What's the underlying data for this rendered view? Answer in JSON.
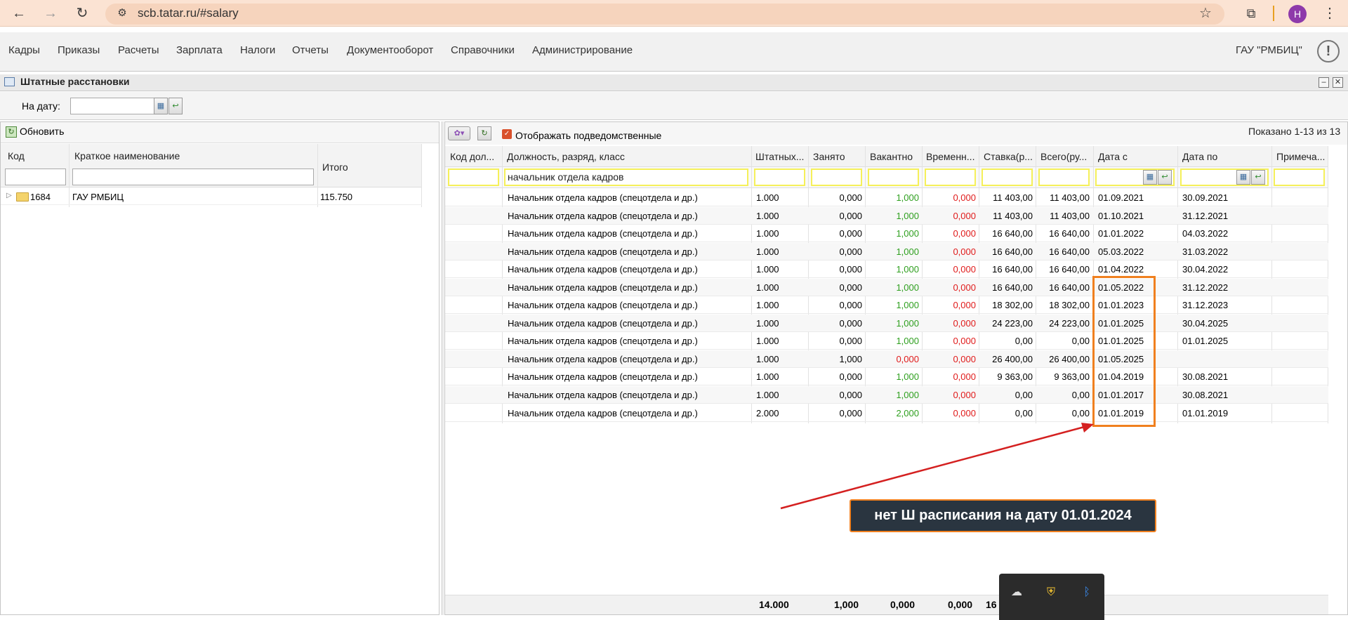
{
  "browser": {
    "url": "scb.tatar.ru/#salary",
    "profile_initial": "H"
  },
  "menu": {
    "items": [
      "Кадры",
      "Приказы",
      "Расчеты",
      "Зарплата",
      "Налоги",
      "Отчеты",
      "Документооборот",
      "Справочники",
      "Администрирование"
    ],
    "org": "ГАУ \"РМБИЦ\""
  },
  "window": {
    "title": "Штатные расстановки",
    "date_label": "На дату:",
    "date_value": ""
  },
  "left": {
    "refresh_label": "Обновить",
    "headers": [
      "Код",
      "Краткое наименование",
      "Итого"
    ],
    "tree": [
      {
        "code": "1684",
        "name": "ГАУ РМБИЦ",
        "total": "115.750"
      }
    ]
  },
  "right": {
    "show_subordinate_label": "Отображать подведомственные",
    "show_subordinate_checked": true,
    "shown_text": "Показано 1-13 из 13",
    "headers": [
      "Код дол...",
      "Должность, разряд, класс",
      "Штатных...",
      "Занято",
      "Вакантно",
      "Временн...",
      "Ставка(р...",
      "Всего(ру...",
      "Дата с",
      "Дата по",
      "Примеча..."
    ],
    "filter_position": "начальник отдела кадров",
    "rows": [
      {
        "pos": "Начальник отдела кадров (спецотдела и др.)",
        "shtat": "1.000",
        "zanyato": "0,000",
        "vakant": "1,000",
        "vrem": "0,000",
        "stavka": "11 403,00",
        "vsego": "11 403,00",
        "date_from": "01.09.2021",
        "date_to": "30.09.2021"
      },
      {
        "pos": "Начальник отдела кадров (спецотдела и др.)",
        "shtat": "1.000",
        "zanyato": "0,000",
        "vakant": "1,000",
        "vrem": "0,000",
        "stavka": "11 403,00",
        "vsego": "11 403,00",
        "date_from": "01.10.2021",
        "date_to": "31.12.2021"
      },
      {
        "pos": "Начальник отдела кадров (спецотдела и др.)",
        "shtat": "1.000",
        "zanyato": "0,000",
        "vakant": "1,000",
        "vrem": "0,000",
        "stavka": "16 640,00",
        "vsego": "16 640,00",
        "date_from": "01.01.2022",
        "date_to": "04.03.2022"
      },
      {
        "pos": "Начальник отдела кадров (спецотдела и др.)",
        "shtat": "1.000",
        "zanyato": "0,000",
        "vakant": "1,000",
        "vrem": "0,000",
        "stavka": "16 640,00",
        "vsego": "16 640,00",
        "date_from": "05.03.2022",
        "date_to": "31.03.2022"
      },
      {
        "pos": "Начальник отдела кадров (спецотдела и др.)",
        "shtat": "1.000",
        "zanyato": "0,000",
        "vakant": "1,000",
        "vrem": "0,000",
        "stavka": "16 640,00",
        "vsego": "16 640,00",
        "date_from": "01.04.2022",
        "date_to": "30.04.2022"
      },
      {
        "pos": "Начальник отдела кадров (спецотдела и др.)",
        "shtat": "1.000",
        "zanyato": "0,000",
        "vakant": "1,000",
        "vrem": "0,000",
        "stavka": "16 640,00",
        "vsego": "16 640,00",
        "date_from": "01.05.2022",
        "date_to": "31.12.2022"
      },
      {
        "pos": "Начальник отдела кадров (спецотдела и др.)",
        "shtat": "1.000",
        "zanyato": "0,000",
        "vakant": "1,000",
        "vrem": "0,000",
        "stavka": "18 302,00",
        "vsego": "18 302,00",
        "date_from": "01.01.2023",
        "date_to": "31.12.2023"
      },
      {
        "pos": "Начальник отдела кадров (спецотдела и др.)",
        "shtat": "1.000",
        "zanyato": "0,000",
        "vakant": "1,000",
        "vrem": "0,000",
        "stavka": "24 223,00",
        "vsego": "24 223,00",
        "date_from": "01.01.2025",
        "date_to": "30.04.2025"
      },
      {
        "pos": "Начальник отдела кадров (спецотдела и др.)",
        "shtat": "1.000",
        "zanyato": "0,000",
        "vakant": "1,000",
        "vrem": "0,000",
        "stavka": "0,00",
        "vsego": "0,00",
        "date_from": "01.01.2025",
        "date_to": "01.01.2025"
      },
      {
        "pos": "Начальник отдела кадров (спецотдела и др.)",
        "shtat": "1.000",
        "zanyato": "1,000",
        "vakant": "0,000",
        "vrem": "0,000",
        "stavka": "26 400,00",
        "vsego": "26 400,00",
        "date_from": "01.05.2025",
        "date_to": ""
      },
      {
        "pos": "Начальник отдела кадров (спецотдела и др.)",
        "shtat": "1.000",
        "zanyato": "0,000",
        "vakant": "1,000",
        "vrem": "0,000",
        "stavka": "9 363,00",
        "vsego": "9 363,00",
        "date_from": "01.04.2019",
        "date_to": "30.08.2021"
      },
      {
        "pos": "Начальник отдела кадров (спецотдела и др.)",
        "shtat": "1.000",
        "zanyato": "0,000",
        "vakant": "1,000",
        "vrem": "0,000",
        "stavka": "0,00",
        "vsego": "0,00",
        "date_from": "01.01.2017",
        "date_to": "30.08.2021"
      },
      {
        "pos": "Начальник отдела кадров (спецотдела и др.)",
        "shtat": "2.000",
        "zanyato": "0,000",
        "vakant": "2,000",
        "vrem": "0,000",
        "stavka": "0,00",
        "vsego": "0,00",
        "date_from": "01.01.2019",
        "date_to": "01.01.2019"
      }
    ],
    "totals": {
      "shtat": "14.000",
      "zanyato": "1,000",
      "vakant": "0,000",
      "vrem": "0,000",
      "stavka": "16"
    }
  },
  "annotation": {
    "text": "нет Ш расписания на дату 01.01.2024",
    "accent_color": "#f0801f",
    "arrow_color": "#d42020"
  }
}
